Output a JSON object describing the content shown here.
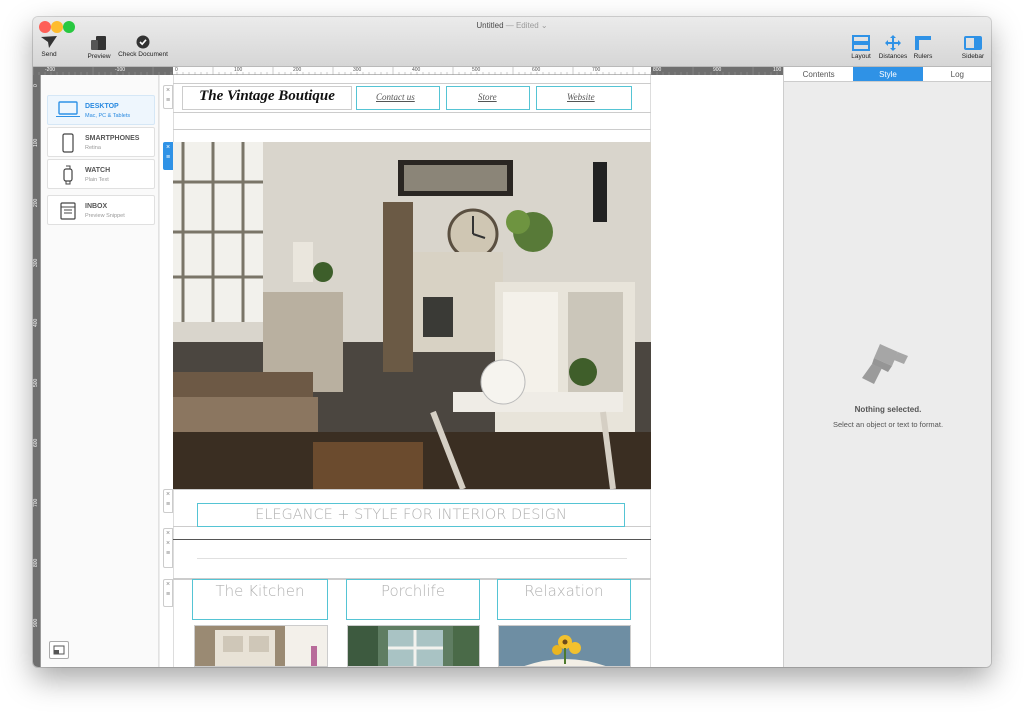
{
  "window": {
    "title": "Untitled",
    "edited": "— Edited ⌄"
  },
  "toolbar": {
    "send": "Send",
    "preview": "Preview",
    "check": "Check Document",
    "layout": "Layout",
    "distances": "Distances",
    "rulers": "Rulers",
    "sidebar": "Sidebar"
  },
  "ruler": {
    "top_labels": [
      "-200",
      "-100",
      "0",
      "100",
      "200",
      "300",
      "400",
      "500",
      "600",
      "700",
      "800",
      "900",
      "100"
    ],
    "left_labels": [
      "0",
      "100",
      "200",
      "300",
      "400",
      "500",
      "600",
      "700",
      "800",
      "900"
    ]
  },
  "devices": [
    {
      "name": "DESKTOP",
      "sub": "Mac, PC & Tablets",
      "selected": true,
      "icon": "laptop-icon"
    },
    {
      "name": "SMARTPHONES",
      "sub": "Retina",
      "selected": false,
      "icon": "phone-icon"
    },
    {
      "name": "WATCH",
      "sub": "Plain Text",
      "selected": false,
      "icon": "watch-icon"
    },
    {
      "name": "INBOX",
      "sub": "Preview Snippet",
      "selected": false,
      "icon": "inbox-icon"
    }
  ],
  "email": {
    "logo": "The Vintage Boutique",
    "nav": [
      "Contact us",
      "Store",
      "Website"
    ],
    "banner": "ELEGANCE + STYLE FOR INTERIOR DESIGN",
    "categories": [
      "The Kitchen",
      "Porchlife",
      "Relaxation"
    ]
  },
  "inspector": {
    "tabs": [
      "Contents",
      "Style",
      "Log"
    ],
    "active_tab": "Style",
    "empty_title": "Nothing selected.",
    "empty_sub": "Select an object or text to format."
  },
  "colors": {
    "accent": "#2f92e6",
    "outline": "#55c4d4"
  }
}
